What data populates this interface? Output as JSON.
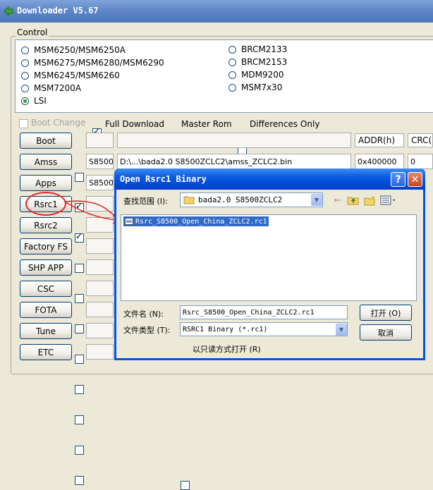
{
  "window": {
    "title": "Downloader V5.67"
  },
  "group": {
    "label": "Control"
  },
  "radios_left": [
    {
      "label": "MSM6250/MSM6250A",
      "selected": false
    },
    {
      "label": "MSM6275/MSM6280/MSM6290",
      "selected": false
    },
    {
      "label": "MSM6245/MSM6260",
      "selected": false
    },
    {
      "label": "MSM7200A",
      "selected": false
    },
    {
      "label": "LSI",
      "selected": true
    }
  ],
  "radios_right": [
    {
      "label": "BRCM2133",
      "selected": false
    },
    {
      "label": "BRCM2153",
      "selected": false
    },
    {
      "label": "MDM9200",
      "selected": false
    },
    {
      "label": "MSM7x30",
      "selected": false
    }
  ],
  "options": {
    "boot_change": {
      "label": "Boot Change",
      "checked": false,
      "disabled": true
    },
    "full_download": {
      "label": "Full Download",
      "checked": true
    },
    "master_rom": {
      "label": "Master Rom",
      "checked": false
    },
    "differences_only": {
      "label": "Differences Only",
      "checked": false
    }
  },
  "columns": {
    "addr": "ADDR(h)",
    "crc": "CRC("
  },
  "rows": [
    {
      "button": "Boot",
      "checked": false,
      "model": "",
      "path": "",
      "addr": "",
      "crc": ""
    },
    {
      "button": "Amss",
      "checked": true,
      "model": "S8500",
      "path": "D:\\...\\bada2.0 S8500ZCLC2\\amss_ZCLC2.bin",
      "addr": "0x400000",
      "crc": "0"
    },
    {
      "button": "Apps",
      "checked": true,
      "model": "S8500",
      "path": "",
      "addr": "",
      "crc": ""
    },
    {
      "button": "Rsrc1",
      "checked": false,
      "model": "",
      "path": "",
      "addr": "",
      "crc": ""
    },
    {
      "button": "Rsrc2",
      "checked": false,
      "model": "",
      "path": "",
      "addr": "",
      "crc": ""
    },
    {
      "button": "Factory FS",
      "checked": false,
      "model": "",
      "path": "",
      "addr": "",
      "crc": ""
    },
    {
      "button": "SHP APP",
      "checked": false,
      "model": "",
      "path": "",
      "addr": "",
      "crc": ""
    },
    {
      "button": "CSC",
      "checked": false,
      "model": "",
      "path": "",
      "addr": "",
      "crc": ""
    },
    {
      "button": "FOTA",
      "checked": false,
      "model": "",
      "path": "",
      "addr": "",
      "crc": ""
    },
    {
      "button": "Tune",
      "checked": false,
      "model": "",
      "path": "",
      "addr": "",
      "crc": ""
    },
    {
      "button": "ETC",
      "checked": false,
      "model": "",
      "path": "",
      "addr": "",
      "crc": ""
    }
  ],
  "dialog": {
    "title": "Open Rsrc1 Binary",
    "help_glyph": "?",
    "close_glyph": "✕",
    "look_in_label": "查找范围 (I):",
    "look_in_value": "bada2.0 S8500ZCLC2",
    "file_item": "Rsrc_S8500_Open_China_ZCLC2.rc1",
    "filename_label": "文件名 (N):",
    "filename_value": "Rsrc_S8500_Open_China_ZCLC2.rc1",
    "filetype_label": "文件类型 (T):",
    "filetype_value": "RSRC1 Binary (*.rc1)",
    "readonly_label": "以只读方式打开 (R)",
    "open_button": "打开 (O)",
    "cancel_button": "取消"
  },
  "colors": {
    "title_bar": "#5c84c6",
    "dialog_title": "#0a5be0",
    "selection": "#316ac5",
    "annotation": "#e52424"
  }
}
